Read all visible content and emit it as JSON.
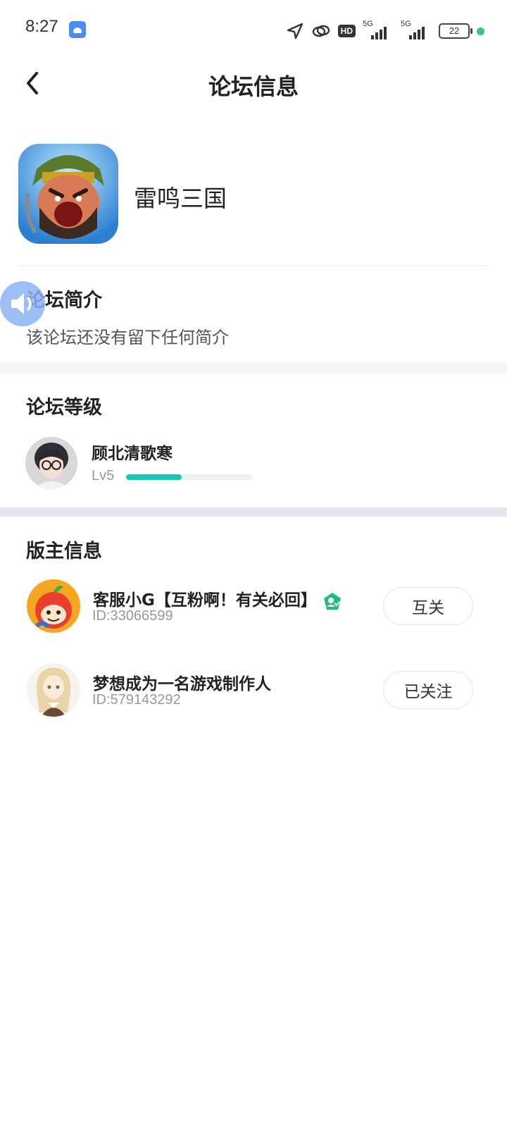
{
  "status_bar": {
    "time": "8:27",
    "hd": "HD",
    "network1": "5G",
    "network2": "5G",
    "battery": "22"
  },
  "header": {
    "title": "论坛信息"
  },
  "forum": {
    "name": "雷鸣三国"
  },
  "intro": {
    "title": "论坛简介",
    "text": "该论坛还没有留下任何简介"
  },
  "level": {
    "title": "论坛等级",
    "user_name": "顾北清歌寒",
    "level_label": "Lv5",
    "progress": 0.44
  },
  "moderators": {
    "title": "版主信息",
    "items": [
      {
        "name": "客服小G【互粉啊！有关必回】",
        "id": "ID:33066599",
        "button": "互关"
      },
      {
        "name": "梦想成为一名游戏制作人",
        "id": "ID:579143292",
        "button": "已关注"
      }
    ]
  },
  "colors": {
    "accent": "#17c9b4",
    "verified": "#1fbf7a",
    "float_button": "#8cb4f5"
  }
}
